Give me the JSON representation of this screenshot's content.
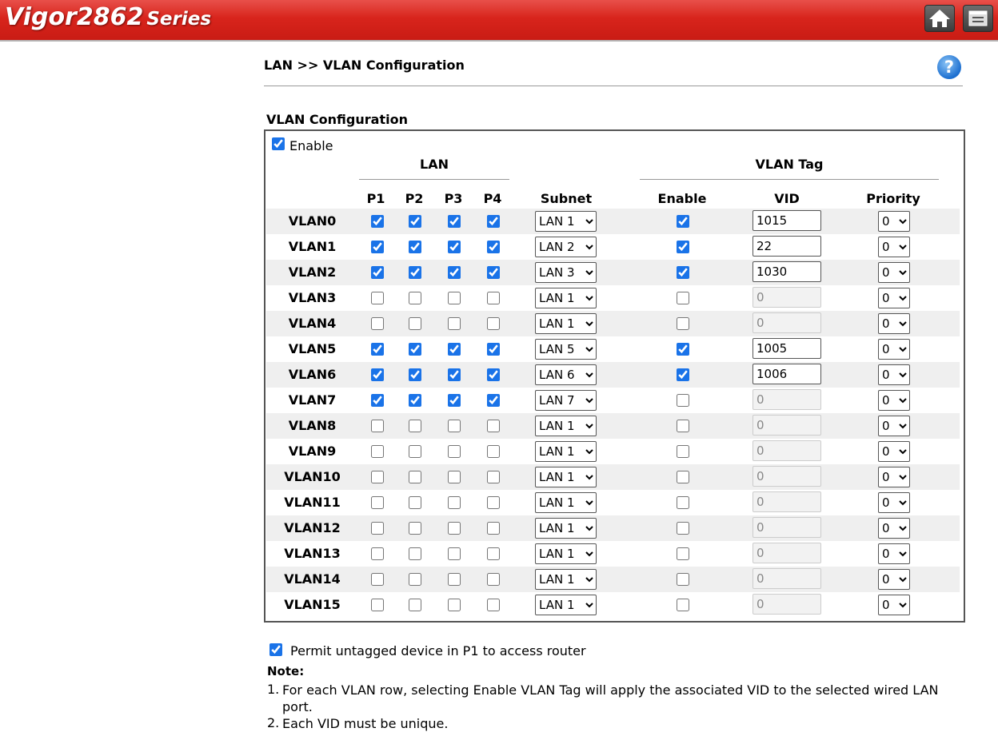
{
  "header": {
    "brand": "Vigor2862",
    "series": "Series",
    "home_icon": "home-icon",
    "menu_icon": "menu-icon",
    "bar_color": "#d8241c"
  },
  "page": {
    "breadcrumb": "LAN >> VLAN Configuration",
    "help_icon": "?",
    "section_title": "VLAN Configuration",
    "enable_label": "Enable",
    "enable_checked": true
  },
  "table": {
    "group_lan": "LAN",
    "group_vlan_tag": "VLAN Tag",
    "columns": {
      "p1": "P1",
      "p2": "P2",
      "p3": "P3",
      "p4": "P4",
      "subnet": "Subnet",
      "enable": "Enable",
      "vid": "VID",
      "priority": "Priority"
    },
    "rows": [
      {
        "name": "VLAN0",
        "p": [
          true,
          true,
          true,
          true
        ],
        "subnet": "LAN 1",
        "tag": true,
        "vid": "1015",
        "priority": "0"
      },
      {
        "name": "VLAN1",
        "p": [
          true,
          true,
          true,
          true
        ],
        "subnet": "LAN 2",
        "tag": true,
        "vid": "22",
        "priority": "0"
      },
      {
        "name": "VLAN2",
        "p": [
          true,
          true,
          true,
          true
        ],
        "subnet": "LAN 3",
        "tag": true,
        "vid": "1030",
        "priority": "0"
      },
      {
        "name": "VLAN3",
        "p": [
          false,
          false,
          false,
          false
        ],
        "subnet": "LAN 1",
        "tag": false,
        "vid": "0",
        "priority": "0"
      },
      {
        "name": "VLAN4",
        "p": [
          false,
          false,
          false,
          false
        ],
        "subnet": "LAN 1",
        "tag": false,
        "vid": "0",
        "priority": "0"
      },
      {
        "name": "VLAN5",
        "p": [
          true,
          true,
          true,
          true
        ],
        "subnet": "LAN 5",
        "tag": true,
        "vid": "1005",
        "priority": "0"
      },
      {
        "name": "VLAN6",
        "p": [
          true,
          true,
          true,
          true
        ],
        "subnet": "LAN 6",
        "tag": true,
        "vid": "1006",
        "priority": "0"
      },
      {
        "name": "VLAN7",
        "p": [
          true,
          true,
          true,
          true
        ],
        "subnet": "LAN 7",
        "tag": false,
        "vid": "0",
        "priority": "0"
      },
      {
        "name": "VLAN8",
        "p": [
          false,
          false,
          false,
          false
        ],
        "subnet": "LAN 1",
        "tag": false,
        "vid": "0",
        "priority": "0"
      },
      {
        "name": "VLAN9",
        "p": [
          false,
          false,
          false,
          false
        ],
        "subnet": "LAN 1",
        "tag": false,
        "vid": "0",
        "priority": "0"
      },
      {
        "name": "VLAN10",
        "p": [
          false,
          false,
          false,
          false
        ],
        "subnet": "LAN 1",
        "tag": false,
        "vid": "0",
        "priority": "0"
      },
      {
        "name": "VLAN11",
        "p": [
          false,
          false,
          false,
          false
        ],
        "subnet": "LAN 1",
        "tag": false,
        "vid": "0",
        "priority": "0"
      },
      {
        "name": "VLAN12",
        "p": [
          false,
          false,
          false,
          false
        ],
        "subnet": "LAN 1",
        "tag": false,
        "vid": "0",
        "priority": "0"
      },
      {
        "name": "VLAN13",
        "p": [
          false,
          false,
          false,
          false
        ],
        "subnet": "LAN 1",
        "tag": false,
        "vid": "0",
        "priority": "0"
      },
      {
        "name": "VLAN14",
        "p": [
          false,
          false,
          false,
          false
        ],
        "subnet": "LAN 1",
        "tag": false,
        "vid": "0",
        "priority": "0"
      },
      {
        "name": "VLAN15",
        "p": [
          false,
          false,
          false,
          false
        ],
        "subnet": "LAN 1",
        "tag": false,
        "vid": "0",
        "priority": "0"
      }
    ]
  },
  "permit": {
    "label": "Permit untagged device in P1 to access router",
    "checked": true
  },
  "notes": {
    "title": "Note:",
    "items": [
      {
        "num": "1.",
        "text": "For each VLAN row, selecting Enable VLAN Tag will apply the associated VID to the selected wired LAN port."
      },
      {
        "num": "2.",
        "text": "Each VID must be unique."
      }
    ]
  }
}
